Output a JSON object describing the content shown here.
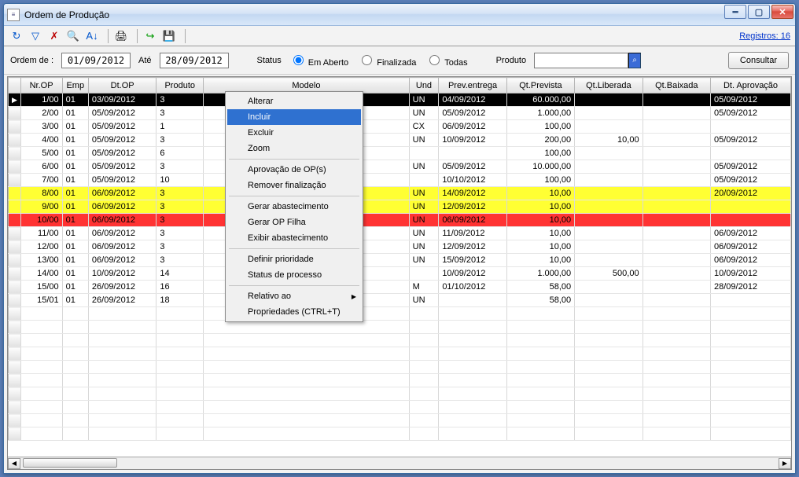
{
  "window_title": "Ordem de Produção",
  "registros_link": "Registros: 16",
  "filter": {
    "label_de": "Ordem de :",
    "date_from": "01/09/2012",
    "label_ate": "Até",
    "date_to": "28/09/2012",
    "label_status": "Status",
    "radio_aberto": "Em Aberto",
    "radio_finalizada": "Finalizada",
    "radio_todas": "Todas",
    "label_produto": "Produto",
    "produto_value": "",
    "consultar_btn": "Consultar"
  },
  "columns": {
    "nrop": "Nr.OP",
    "emp": "Emp",
    "dtop": "Dt.OP",
    "produto": "Produto",
    "modelo": "Modelo",
    "und": "Und",
    "prev": "Prev.entrega",
    "qtprev": "Qt.Prevista",
    "qtlib": "Qt.Liberada",
    "qtbx": "Qt.Baixada",
    "dtapr": "Dt. Aprovação"
  },
  "rows": [
    {
      "nrop": "1/00",
      "emp": "01",
      "dtop": "03/09/2012",
      "produto": "3",
      "modelo": "",
      "und": "UN",
      "prev": "04/09/2012",
      "qtprev": "60.000,00",
      "qtlib": "",
      "qtbx": "",
      "dtapr": "05/09/2012",
      "state": "sel"
    },
    {
      "nrop": "2/00",
      "emp": "01",
      "dtop": "05/09/2012",
      "produto": "3",
      "modelo": "",
      "und": "UN",
      "prev": "05/09/2012",
      "qtprev": "1.000,00",
      "qtlib": "",
      "qtbx": "",
      "dtapr": "05/09/2012",
      "state": ""
    },
    {
      "nrop": "3/00",
      "emp": "01",
      "dtop": "05/09/2012",
      "produto": "1",
      "modelo": "",
      "und": "CX",
      "prev": "06/09/2012",
      "qtprev": "100,00",
      "qtlib": "",
      "qtbx": "",
      "dtapr": "",
      "state": ""
    },
    {
      "nrop": "4/00",
      "emp": "01",
      "dtop": "05/09/2012",
      "produto": "3",
      "modelo": "",
      "und": "UN",
      "prev": "10/09/2012",
      "qtprev": "200,00",
      "qtlib": "10,00",
      "qtbx": "",
      "dtapr": "05/09/2012",
      "state": ""
    },
    {
      "nrop": "5/00",
      "emp": "01",
      "dtop": "05/09/2012",
      "produto": "6",
      "modelo": "",
      "und": "",
      "prev": "",
      "qtprev": "100,00",
      "qtlib": "",
      "qtbx": "",
      "dtapr": "",
      "state": ""
    },
    {
      "nrop": "6/00",
      "emp": "01",
      "dtop": "05/09/2012",
      "produto": "3",
      "modelo": "",
      "und": "UN",
      "prev": "05/09/2012",
      "qtprev": "10.000,00",
      "qtlib": "",
      "qtbx": "",
      "dtapr": "05/09/2012",
      "state": ""
    },
    {
      "nrop": "7/00",
      "emp": "01",
      "dtop": "05/09/2012",
      "produto": "10",
      "modelo": "",
      "und": "",
      "prev": "10/10/2012",
      "qtprev": "100,00",
      "qtlib": "",
      "qtbx": "",
      "dtapr": "05/09/2012",
      "state": ""
    },
    {
      "nrop": "8/00",
      "emp": "01",
      "dtop": "06/09/2012",
      "produto": "3",
      "modelo": "",
      "und": "UN",
      "prev": "14/09/2012",
      "qtprev": "10,00",
      "qtlib": "",
      "qtbx": "",
      "dtapr": "20/09/2012",
      "state": "yellow"
    },
    {
      "nrop": "9/00",
      "emp": "01",
      "dtop": "06/09/2012",
      "produto": "3",
      "modelo": "",
      "und": "UN",
      "prev": "12/09/2012",
      "qtprev": "10,00",
      "qtlib": "",
      "qtbx": "",
      "dtapr": "",
      "state": "yellow"
    },
    {
      "nrop": "10/00",
      "emp": "01",
      "dtop": "06/09/2012",
      "produto": "3",
      "modelo": "",
      "und": "UN",
      "prev": "06/09/2012",
      "qtprev": "10,00",
      "qtlib": "",
      "qtbx": "",
      "dtapr": "",
      "state": "red"
    },
    {
      "nrop": "11/00",
      "emp": "01",
      "dtop": "06/09/2012",
      "produto": "3",
      "modelo": "",
      "und": "UN",
      "prev": "11/09/2012",
      "qtprev": "10,00",
      "qtlib": "",
      "qtbx": "",
      "dtapr": "06/09/2012",
      "state": ""
    },
    {
      "nrop": "12/00",
      "emp": "01",
      "dtop": "06/09/2012",
      "produto": "3",
      "modelo": "",
      "und": "UN",
      "prev": "12/09/2012",
      "qtprev": "10,00",
      "qtlib": "",
      "qtbx": "",
      "dtapr": "06/09/2012",
      "state": ""
    },
    {
      "nrop": "13/00",
      "emp": "01",
      "dtop": "06/09/2012",
      "produto": "3",
      "modelo": "",
      "und": "UN",
      "prev": "15/09/2012",
      "qtprev": "10,00",
      "qtlib": "",
      "qtbx": "",
      "dtapr": "06/09/2012",
      "state": ""
    },
    {
      "nrop": "14/00",
      "emp": "01",
      "dtop": "10/09/2012",
      "produto": "14",
      "modelo": "",
      "und": "",
      "prev": "10/09/2012",
      "qtprev": "1.000,00",
      "qtlib": "500,00",
      "qtbx": "",
      "dtapr": "10/09/2012",
      "state": ""
    },
    {
      "nrop": "15/00",
      "emp": "01",
      "dtop": "26/09/2012",
      "produto": "16",
      "modelo": "",
      "und": "M",
      "prev": "01/10/2012",
      "qtprev": "58,00",
      "qtlib": "",
      "qtbx": "",
      "dtapr": "28/09/2012",
      "state": ""
    },
    {
      "nrop": "15/01",
      "emp": "01",
      "dtop": "26/09/2012",
      "produto": "18",
      "modelo": "",
      "und": "UN",
      "prev": "",
      "qtprev": "58,00",
      "qtlib": "",
      "qtbx": "",
      "dtapr": "",
      "state": ""
    }
  ],
  "context_menu": {
    "alterar": "Alterar",
    "incluir": "Incluir",
    "excluir": "Excluir",
    "zoom": "Zoom",
    "aprovacao": "Aprovação de OP(s)",
    "remover": "Remover finalização",
    "gerar_ab": "Gerar abastecimento",
    "gerar_op": "Gerar OP Filha",
    "exibir_ab": "Exibir abastecimento",
    "definir": "Definir prioridade",
    "status_proc": "Status de processo",
    "relativo": "Relativo ao",
    "props": "Propriedades (CTRL+T)"
  }
}
